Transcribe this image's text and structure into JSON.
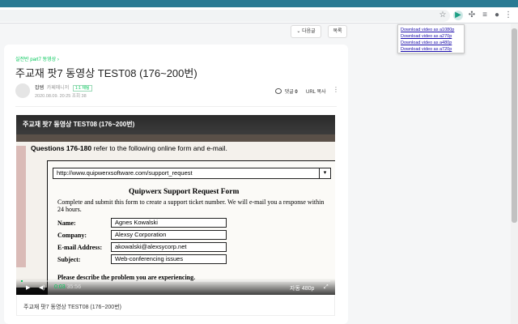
{
  "browser": {
    "icons": [
      "star-icon",
      "play-extension-icon",
      "puzzle-icon",
      "reading-list-icon",
      "profile-icon",
      "menu-icon"
    ],
    "accent": "#2a7a93"
  },
  "download_menu": {
    "items": [
      "Download video as a1080p",
      "Download video as a270p",
      "Download video as a480p",
      "Download video as a720p"
    ]
  },
  "nav": {
    "next_label": "다음글",
    "list_label": "목록"
  },
  "post": {
    "board": "실전반 part7 동영상",
    "title": "주교재 팟7 동영상 TEST08 (176~200번)",
    "author": "잡쌤",
    "role": "카페매니저",
    "chat_badge": "1:1 채팅",
    "date": "2020.08.09. 20:25",
    "views": "조회 38",
    "comments_label": "댓글",
    "comments_count": "0",
    "url_copy": "URL 복사",
    "caption": "주교재 팟7 동영상 TEST08 (176~200번)"
  },
  "video": {
    "title": "주교재 팟7 동영상 TEST08 (176~200번)",
    "question_range": "Questions 176-180",
    "question_text": "refer to the following online form and e-mail.",
    "url": "http://www.quipwerxsoftware.com/support_request",
    "form_title": "Quipwerx Support Request Form",
    "form_intro": "Complete and submit this form to create a support ticket number. We will e-mail you a response within 24 hours.",
    "fields": [
      {
        "label": "Name:",
        "value": "Agnes Kowalski"
      },
      {
        "label": "Company:",
        "value": "Alexsy Corporation"
      },
      {
        "label": "E-mail Address:",
        "value": "akowalski@alexsycorp.net"
      },
      {
        "label": "Subject:",
        "value": "Web-conferencing issues"
      }
    ],
    "describe_prompt": "Please describe the problem you are experiencing.",
    "current_time": "0:03",
    "total_time": "35:56",
    "progress": 0.0014,
    "quality_label": "자동",
    "quality_value": "480p"
  }
}
